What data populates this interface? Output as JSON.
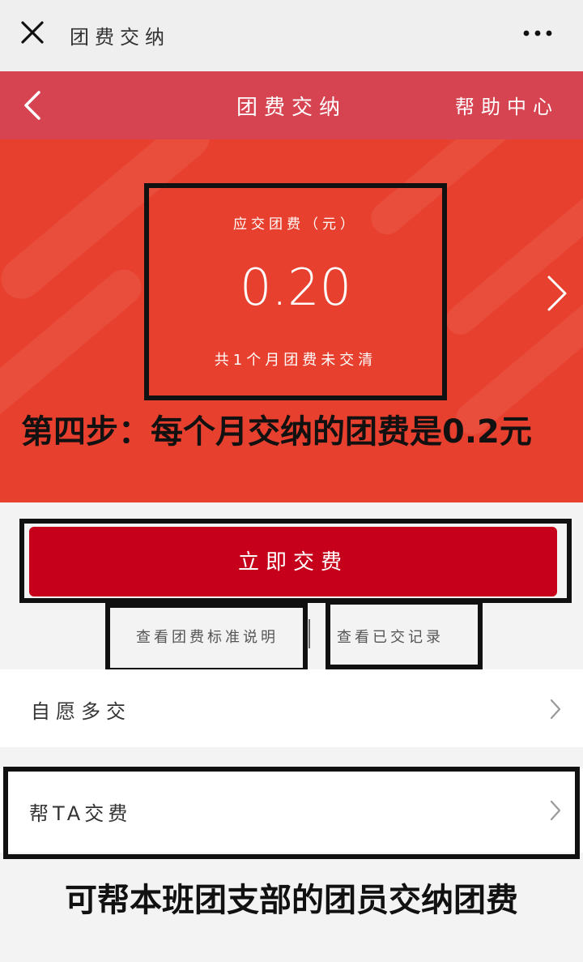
{
  "top_bar": {
    "title": "团费交纳"
  },
  "header": {
    "title": "团费交纳",
    "help": "帮助中心"
  },
  "fee": {
    "label": "应交团费（元）",
    "amount": "0.20",
    "note": "共1个月团费未交清"
  },
  "annotations": {
    "step_caption": "第四步：每个月交纳的团费是0.2元",
    "bottom_caption": "可帮本班团支部的团员交纳团费"
  },
  "actions": {
    "pay_button": "立即交费",
    "standard_link": "查看团费标准说明",
    "separator": "|",
    "records_link": "查看已交记录"
  },
  "list": {
    "voluntary": "自愿多交",
    "pay_for_others": "帮TA交费"
  },
  "colors": {
    "header_red": "#d64351",
    "hero_orange": "#e8402e",
    "button_red": "#c6001a"
  }
}
